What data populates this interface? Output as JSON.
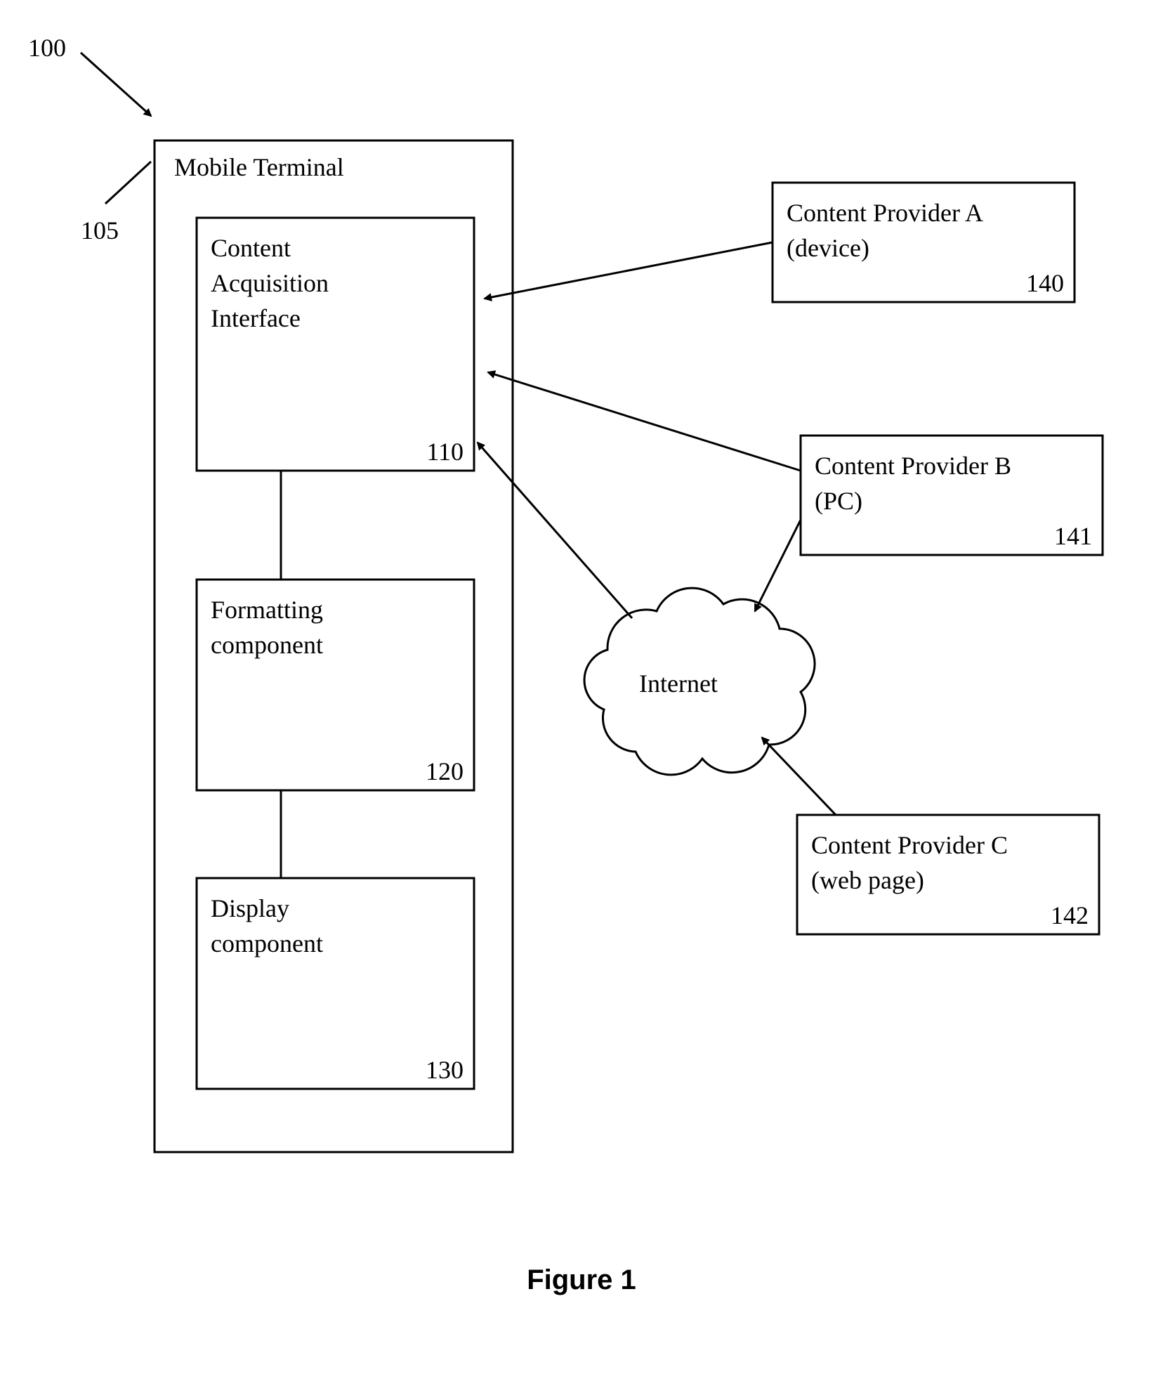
{
  "figure": {
    "id_label": "100",
    "caption": "Figure 1"
  },
  "mobile_terminal": {
    "title": "Mobile Terminal",
    "ref": "105",
    "components": {
      "acquisition": {
        "line1": "Content",
        "line2": "Acquisition",
        "line3": "Interface",
        "ref": "110"
      },
      "formatting": {
        "line1": "Formatting",
        "line2": "component",
        "ref": "120"
      },
      "display": {
        "line1": "Display",
        "line2": "component",
        "ref": "130"
      }
    }
  },
  "cloud": {
    "label": "Internet"
  },
  "providers": {
    "a": {
      "line1": "Content Provider A",
      "line2": "(device)",
      "ref": "140"
    },
    "b": {
      "line1": "Content Provider B",
      "line2": "(PC)",
      "ref": "141"
    },
    "c": {
      "line1": "Content Provider C",
      "line2": "(web page)",
      "ref": "142"
    }
  }
}
